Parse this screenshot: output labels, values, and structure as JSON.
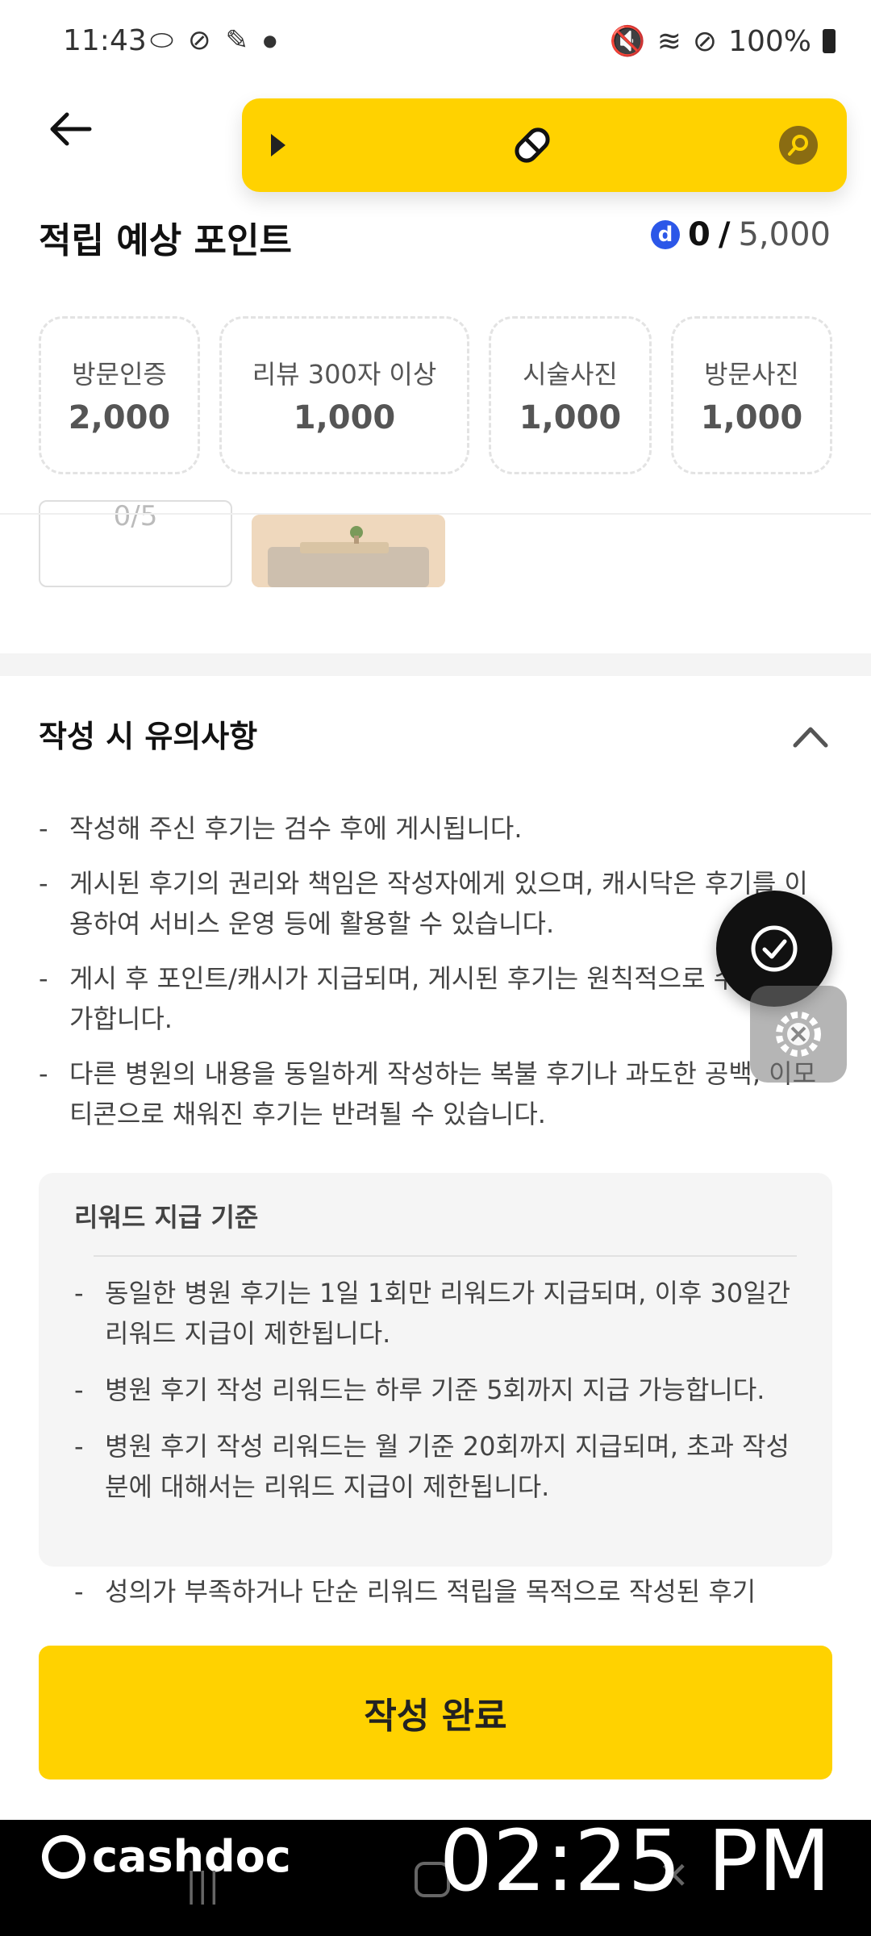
{
  "status_bar": {
    "time": "11:43",
    "battery": "100%"
  },
  "header": {
    "title": "적립 예상 포인트",
    "points_current": "0",
    "points_separator": "/",
    "points_max": "5,000"
  },
  "point_cards": [
    {
      "label": "방문인증",
      "value": "2,000"
    },
    {
      "label": "리뷰 300자 이상",
      "value": "1,000"
    },
    {
      "label": "시술사진",
      "value": "1,000"
    },
    {
      "label": "방문사진",
      "value": "1,000"
    }
  ],
  "photo_section": {
    "counter": "0/5"
  },
  "notes": {
    "title": "작성 시 유의사항",
    "items": [
      "작성해 주신 후기는 검수 후에 게시됩니다.",
      "게시된 후기의 권리와 책임은 작성자에게 있으며, 캐시닥은 후기를 이용하여 서비스 운영 등에 활용할 수 있습니다.",
      "게시 후 포인트/캐시가 지급되며, 게시된 후기는 원칙적으로 수정이 불가합니다.",
      "다른 병원의 내용을 동일하게 작성하는 복불 후기나 과도한 공백, 이모티콘으로 채워진 후기는 반려될 수 있습니다."
    ]
  },
  "reward": {
    "title": "리워드 지급 기준",
    "items": [
      "동일한 병원 후기는 1일 1회만 리워드가 지급되며, 이후 30일간 리워드 지급이 제한됩니다.",
      "병원 후기 작성 리워드는 하루 기준 5회까지 지급 가능합니다.",
      "병원 후기 작성 리워드는 월 기준 20회까지 지급되며, 초과 작성분에 대해서는 리워드 지급이 제한됩니다."
    ],
    "extra": "성의가 부족하거나 단순 리워드 적립을 목적으로 작성된 후기"
  },
  "submit_button": "작성 완료",
  "watermark": {
    "brand": "cashdoc",
    "clock": "02:25 PM"
  }
}
